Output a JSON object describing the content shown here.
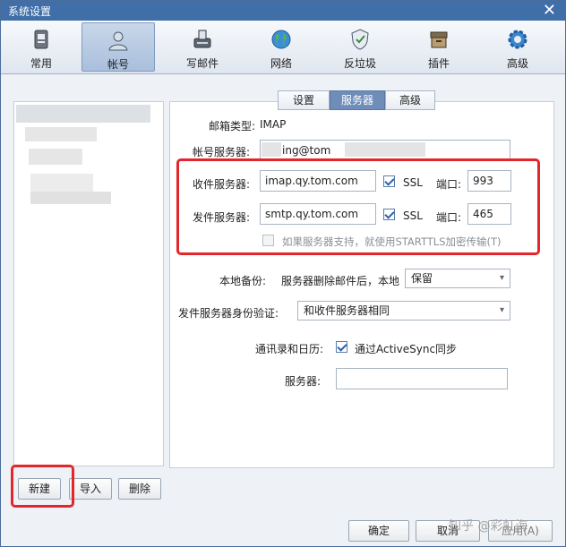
{
  "window": {
    "title": "系统设置",
    "close_glyph": "✕"
  },
  "toolbar": {
    "items": [
      {
        "label": "常用",
        "icon": "general-icon"
      },
      {
        "label": "帐号",
        "icon": "account-icon"
      },
      {
        "label": "写邮件",
        "icon": "compose-icon"
      },
      {
        "label": "网络",
        "icon": "network-icon"
      },
      {
        "label": "反垃圾",
        "icon": "antispam-shield-icon"
      },
      {
        "label": "插件",
        "icon": "plugin-icon"
      },
      {
        "label": "高级",
        "icon": "advanced-gear-icon"
      }
    ],
    "active": "帐号"
  },
  "tabs": {
    "settings": "设置",
    "server": "服务器",
    "advanced": "高级",
    "active": "服务器"
  },
  "form": {
    "mailbox_type_label": "邮箱类型:",
    "mailbox_type_value": "IMAP",
    "account_server_label": "帐号服务器:",
    "account_server_value": "ing@tom",
    "incoming_label": "收件服务器:",
    "incoming_value": "imap.qy.tom.com",
    "incoming_ssl": "SSL",
    "incoming_port_label": "端口:",
    "incoming_port": "993",
    "outgoing_label": "发件服务器:",
    "outgoing_value": "smtp.qy.tom.com",
    "outgoing_ssl": "SSL",
    "outgoing_port_label": "端口:",
    "outgoing_port": "465",
    "starttls_label": "如果服务器支持，就使用STARTTLS加密传输(T)",
    "backup_label": "本地备份:",
    "backup_desc": "服务器删除邮件后，本地",
    "backup_value": "保留",
    "auth_label": "发件服务器身份验证:",
    "auth_value": "和收件服务器相同",
    "contacts_label": "通讯录和日历:",
    "activesync_label": "通过ActiveSync同步",
    "server_label": "服务器:",
    "server_value": ""
  },
  "left_buttons": {
    "new": "新建",
    "import": "导入",
    "delete": "删除"
  },
  "footer": {
    "ok": "确定",
    "cancel": "取消",
    "apply": "应用(A)"
  },
  "watermark": "知乎 @彩虹海",
  "colors": {
    "accent": "#3f6ea8",
    "highlight_box": "#e3262b",
    "active_tab": "#6e8db8"
  }
}
